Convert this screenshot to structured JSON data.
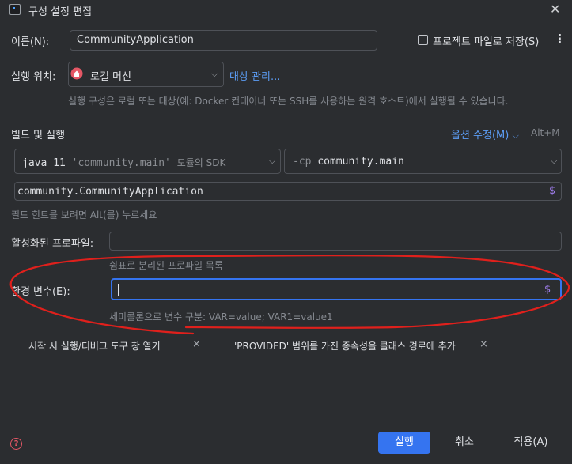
{
  "window": {
    "title": "구성 설정 편집"
  },
  "name": {
    "label": "이름(N):",
    "value": "CommunityApplication"
  },
  "store_as_project_file": {
    "label": "프로젝트 파일로 저장(S)",
    "checked": false
  },
  "run_on": {
    "label": "실행 위치:",
    "value": "로컬 머신",
    "manage_link": "대상 관리...",
    "hint": "실행 구성은 로컬 또는 대상(예: Docker 컨테이너 또는 SSH를 사용하는 원격 호스트)에서 실행될 수 있습니다."
  },
  "build_run": {
    "section_label": "빌드 및 실행",
    "modify_options": "옵션 수정(M)",
    "modify_shortcut": "Alt+M",
    "sdk_keyword": "java 11",
    "sdk_module": "'community.main'",
    "sdk_suffix": "모듈의 SDK",
    "cp_flag": "-cp",
    "cp_value": "community.main",
    "main_class": "community.CommunityApplication",
    "field_hint": "필드 힌트를 보려면 Alt(를) 누르세요"
  },
  "profiles": {
    "label": "활성화된 프로파일:",
    "value": "",
    "hint": "쉼표로 분리된 프로파일 목록"
  },
  "env": {
    "label": "환경 변수(E):",
    "value": "",
    "hint": "세미콜론으로 변수 구분: VAR=value; VAR1=value1"
  },
  "options": [
    {
      "label": "시작 시 실행/디버그 도구 창 열기",
      "remove": "×"
    },
    {
      "label": "'PROVIDED' 범위를 가진 종속성을 클래스 경로에 추가",
      "remove": "×"
    }
  ],
  "footer": {
    "help": "?",
    "run": "실행",
    "cancel": "취소",
    "apply": "적용(A)"
  },
  "icons": {
    "app": "app-icon",
    "close": "close-icon",
    "home": "home-icon",
    "chevron": "chevron-down-icon",
    "macro": "dollar-icon",
    "more": "more-vert-icon"
  }
}
